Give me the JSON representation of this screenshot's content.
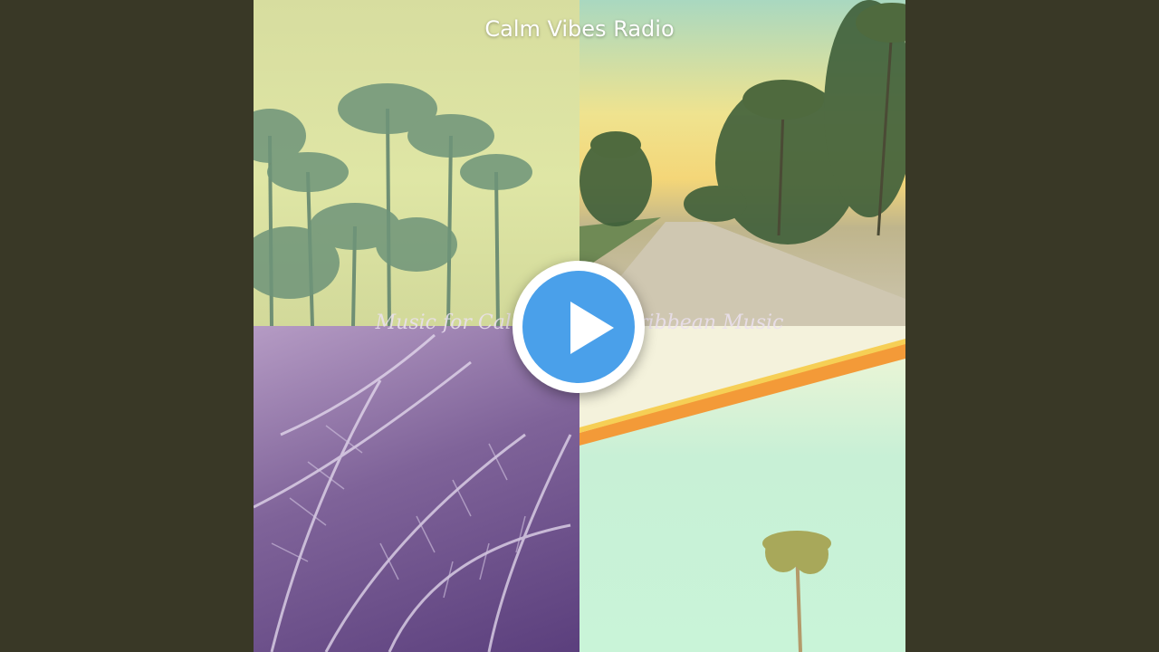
{
  "channel": {
    "title": "Calm Vibes Radio"
  },
  "album": {
    "subtitle": "Music for Calm Vibes - Caribbean Music"
  },
  "player": {
    "play_icon": "play-icon",
    "play_color": "#4aa0ea"
  },
  "colors": {
    "background": "#393826"
  }
}
